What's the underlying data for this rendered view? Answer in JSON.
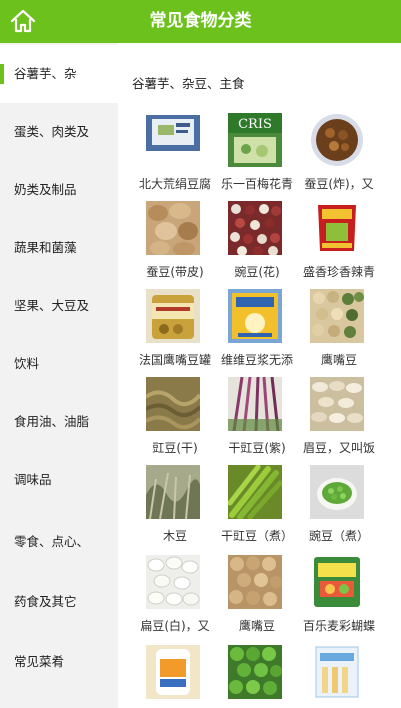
{
  "header": {
    "title": "常见食物分类",
    "home_icon": "home-icon",
    "accent": "#6cc11d"
  },
  "sidebar": {
    "items": [
      {
        "label": "谷薯芋、杂"
      },
      {
        "label": "蛋类、肉类及"
      },
      {
        "label": "奶类及制品"
      },
      {
        "label": "蔬果和菌藻"
      },
      {
        "label": "坚果、大豆及"
      },
      {
        "label": "饮料"
      },
      {
        "label": "食用油、油脂"
      },
      {
        "label": "调味品"
      },
      {
        "label": "零食、点心、"
      },
      {
        "label": "药食及其它"
      },
      {
        "label": "常见菜肴"
      }
    ],
    "active_index": 0
  },
  "main": {
    "section_title": "谷薯芋、杂豆、主食",
    "foods": [
      {
        "name": "北大荒绢豆腐"
      },
      {
        "name": "乐一百梅花青"
      },
      {
        "name": "蚕豆(炸)，又"
      },
      {
        "name": "蚕豆(带皮)"
      },
      {
        "name": "豌豆(花)"
      },
      {
        "name": "盛香珍香辣青"
      },
      {
        "name": "法国鹰嘴豆罐"
      },
      {
        "name": "维维豆浆无添"
      },
      {
        "name": "鹰嘴豆"
      },
      {
        "name": "豇豆(干)"
      },
      {
        "name": "干豇豆(紫)"
      },
      {
        "name": "眉豆，又叫饭"
      },
      {
        "name": "木豆"
      },
      {
        "name": "干豇豆（煮）"
      },
      {
        "name": "豌豆（煮）"
      },
      {
        "name": "扁豆(白)，又"
      },
      {
        "name": "鹰嘴豆"
      },
      {
        "name": "百乐麦彩蝴蝶"
      },
      {
        "name": ""
      },
      {
        "name": ""
      },
      {
        "name": ""
      }
    ],
    "image_texts": {
      "cris": "CRIS"
    }
  }
}
